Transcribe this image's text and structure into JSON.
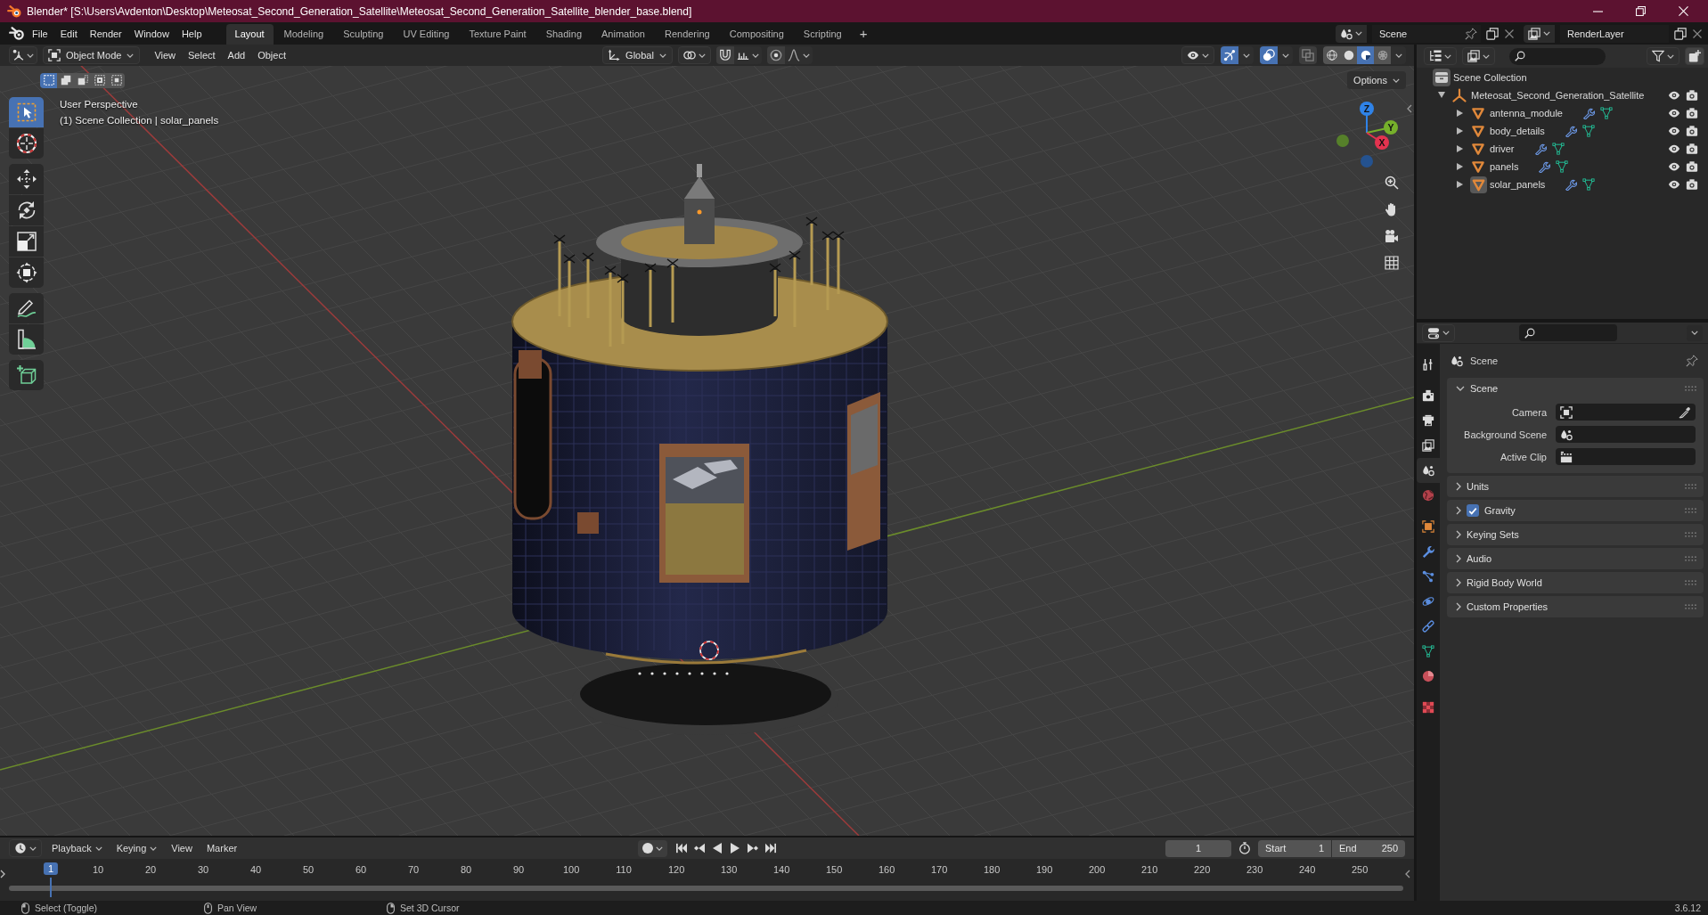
{
  "window": {
    "title": "Blender* [S:\\Users\\Avdenton\\Desktop\\Meteosat_Second_Generation_Satellite\\Meteosat_Second_Generation_Satellite_blender_base.blend]"
  },
  "menu": [
    "File",
    "Edit",
    "Render",
    "Window",
    "Help"
  ],
  "workspaces": [
    {
      "label": "Layout",
      "selected": true
    },
    {
      "label": "Modeling",
      "selected": false
    },
    {
      "label": "Sculpting",
      "selected": false
    },
    {
      "label": "UV Editing",
      "selected": false
    },
    {
      "label": "Texture Paint",
      "selected": false
    },
    {
      "label": "Shading",
      "selected": false
    },
    {
      "label": "Animation",
      "selected": false
    },
    {
      "label": "Rendering",
      "selected": false
    },
    {
      "label": "Compositing",
      "selected": false
    },
    {
      "label": "Scripting",
      "selected": false
    }
  ],
  "add_workspace": "+",
  "scene_selector": {
    "value": "Scene"
  },
  "view_layer_selector": {
    "value": "RenderLayer"
  },
  "viewport": {
    "mode": "Object Mode",
    "menus": [
      "View",
      "Select",
      "Add",
      "Object"
    ],
    "orientation": "Global",
    "toggles": [
      {
        "kind": "gizmos",
        "on": true
      },
      {
        "kind": "overlays",
        "on": true
      },
      {
        "kind": "xray",
        "on": false
      }
    ],
    "shading": [
      {
        "kind": "wireframe",
        "selected": false
      },
      {
        "kind": "solid",
        "selected": false
      },
      {
        "kind": "material",
        "selected": true
      },
      {
        "kind": "rendered",
        "selected": false
      }
    ],
    "select_modes": [
      {
        "kind": "set",
        "selected": true
      },
      {
        "kind": "extend",
        "selected": false
      },
      {
        "kind": "subtract",
        "selected": false
      },
      {
        "kind": "invert",
        "selected": false
      },
      {
        "kind": "intersect",
        "selected": false
      }
    ],
    "options": "Options",
    "view_name": "User Perspective",
    "context": "(1) Scene Collection | solar_panels",
    "tool_groups": [
      {
        "tools": [
          {
            "kind": "select",
            "selected": true
          },
          {
            "kind": "cursor",
            "selected": false
          }
        ]
      },
      {
        "tools": [
          {
            "kind": "move",
            "selected": false
          },
          {
            "kind": "rotate",
            "selected": false
          },
          {
            "kind": "scale",
            "selected": false
          },
          {
            "kind": "transform",
            "selected": false
          }
        ]
      },
      {
        "tools": [
          {
            "kind": "annotate",
            "selected": false
          },
          {
            "kind": "measure",
            "selected": false
          }
        ]
      },
      {
        "tools": [
          {
            "kind": "add_cube",
            "selected": false
          }
        ]
      }
    ],
    "gizmo": [
      {
        "kind": "z",
        "label": "Z"
      },
      {
        "kind": "y",
        "label": "Y"
      },
      {
        "kind": "x",
        "label": "X"
      }
    ]
  },
  "outliner": {
    "tree": [
      {
        "label": "Scene Collection",
        "kind": "scene_collection",
        "children": [
          {
            "label": "Meteosat_Second_Generation_Satellite",
            "kind": "empty",
            "expanded": true,
            "children": [
              {
                "label": "antenna_module",
                "kind": "mesh",
                "expanded": false,
                "active": false
              },
              {
                "label": "body_details",
                "kind": "mesh",
                "expanded": false,
                "active": false
              },
              {
                "label": "driver",
                "kind": "mesh",
                "expanded": false,
                "active": false
              },
              {
                "label": "panels",
                "kind": "mesh",
                "expanded": false,
                "active": false
              },
              {
                "label": "solar_panels",
                "kind": "mesh",
                "expanded": false,
                "active": true
              }
            ]
          }
        ]
      }
    ]
  },
  "properties": {
    "tab_groups": [
      {
        "tabs": [
          {
            "kind": "tool",
            "selected": false
          }
        ]
      },
      {
        "tabs": [
          {
            "kind": "render",
            "selected": false
          },
          {
            "kind": "output",
            "selected": false
          },
          {
            "kind": "view_layer",
            "selected": false
          },
          {
            "kind": "scene",
            "selected": true
          },
          {
            "kind": "world",
            "selected": false
          }
        ]
      },
      {
        "tabs": [
          {
            "kind": "object",
            "selected": false
          },
          {
            "kind": "modifiers",
            "selected": false
          },
          {
            "kind": "particles",
            "selected": false
          },
          {
            "kind": "physics",
            "selected": false
          },
          {
            "kind": "constraints",
            "selected": false
          },
          {
            "kind": "data",
            "selected": false
          },
          {
            "kind": "material",
            "selected": false
          }
        ]
      },
      {
        "tabs": [
          {
            "kind": "texture",
            "selected": false
          }
        ]
      }
    ],
    "context": "Scene",
    "panels": [
      {
        "title": "Scene",
        "kind": "plain",
        "expanded": true,
        "fields": [
          {
            "label": "Camera",
            "kind": "camera"
          },
          {
            "label": "Background Scene",
            "kind": "scene"
          },
          {
            "label": "Active Clip",
            "kind": "clip"
          }
        ]
      },
      {
        "title": "Units",
        "kind": "plain",
        "expanded": false
      },
      {
        "title": "Gravity",
        "kind": "checkbox",
        "checked": true,
        "expanded": false
      },
      {
        "title": "Keying Sets",
        "kind": "plain",
        "expanded": false
      },
      {
        "title": "Audio",
        "kind": "plain",
        "expanded": false
      },
      {
        "title": "Rigid Body World",
        "kind": "plain",
        "expanded": false
      },
      {
        "title": "Custom Properties",
        "kind": "plain",
        "expanded": false
      }
    ]
  },
  "timeline": {
    "menus": [
      {
        "label": "Playback",
        "kind": "dropdown"
      },
      {
        "label": "Keying",
        "kind": "dropdown"
      },
      {
        "label": "View",
        "kind": "menu"
      },
      {
        "label": "Marker",
        "kind": "menu"
      }
    ],
    "current_frame": "1",
    "start": {
      "label": "Start",
      "value": "1"
    },
    "end": {
      "label": "End",
      "value": "250"
    },
    "ruler": [
      {
        "label": "1",
        "selected": true
      },
      {
        "label": "10",
        "selected": false
      },
      {
        "label": "20",
        "selected": false
      },
      {
        "label": "30",
        "selected": false
      },
      {
        "label": "40",
        "selected": false
      },
      {
        "label": "50",
        "selected": false
      },
      {
        "label": "60",
        "selected": false
      },
      {
        "label": "70",
        "selected": false
      },
      {
        "label": "80",
        "selected": false
      },
      {
        "label": "90",
        "selected": false
      },
      {
        "label": "100",
        "selected": false
      },
      {
        "label": "110",
        "selected": false
      },
      {
        "label": "120",
        "selected": false
      },
      {
        "label": "130",
        "selected": false
      },
      {
        "label": "140",
        "selected": false
      },
      {
        "label": "150",
        "selected": false
      },
      {
        "label": "160",
        "selected": false
      },
      {
        "label": "170",
        "selected": false
      },
      {
        "label": "180",
        "selected": false
      },
      {
        "label": "190",
        "selected": false
      },
      {
        "label": "200",
        "selected": false
      },
      {
        "label": "210",
        "selected": false
      },
      {
        "label": "220",
        "selected": false
      },
      {
        "label": "230",
        "selected": false
      },
      {
        "label": "240",
        "selected": false
      },
      {
        "label": "250",
        "selected": false
      }
    ]
  },
  "status_bar": {
    "hints": [
      {
        "kind": "left",
        "label": "Select (Toggle)"
      },
      {
        "kind": "middle",
        "label": "Pan View"
      },
      {
        "kind": "right",
        "label": "Set 3D Cursor"
      }
    ],
    "version": "3.6.12"
  }
}
